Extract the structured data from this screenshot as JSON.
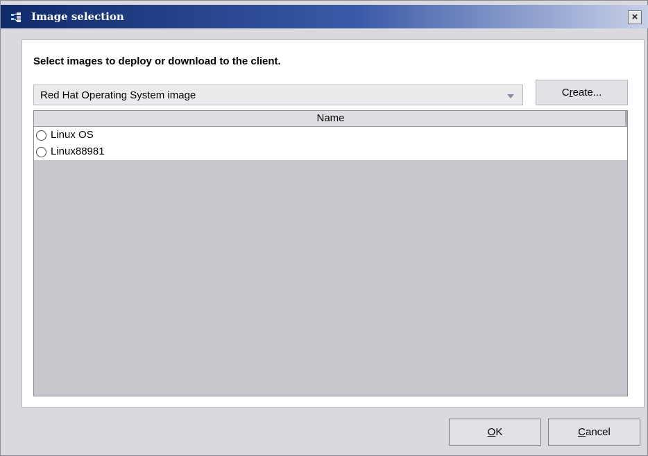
{
  "window": {
    "title": "Image selection",
    "close_glyph": "×",
    "icon": "app-tree-icon"
  },
  "content": {
    "heading": "Select images to deploy or download to the client.",
    "image_type_select": {
      "selected": "Red Hat Operating System image",
      "arrow_icon": "chevron-down-icon"
    },
    "create_button": {
      "pre": "C",
      "mnemonic": "r",
      "post": "eate..."
    }
  },
  "table": {
    "column_header": "Name",
    "rows": [
      {
        "label": "Linux OS",
        "selected": false
      },
      {
        "label": "Linux88981",
        "selected": false
      }
    ]
  },
  "footer": {
    "ok": {
      "mnemonic": "O",
      "rest": "K"
    },
    "cancel": {
      "mnemonic": "C",
      "rest": "ancel"
    }
  },
  "colors": {
    "title_gradient_start": "#102a6a",
    "title_gradient_end": "#c8d0e8",
    "window_bg": "#d9d9de",
    "table_bg": "#c7c7cd"
  }
}
